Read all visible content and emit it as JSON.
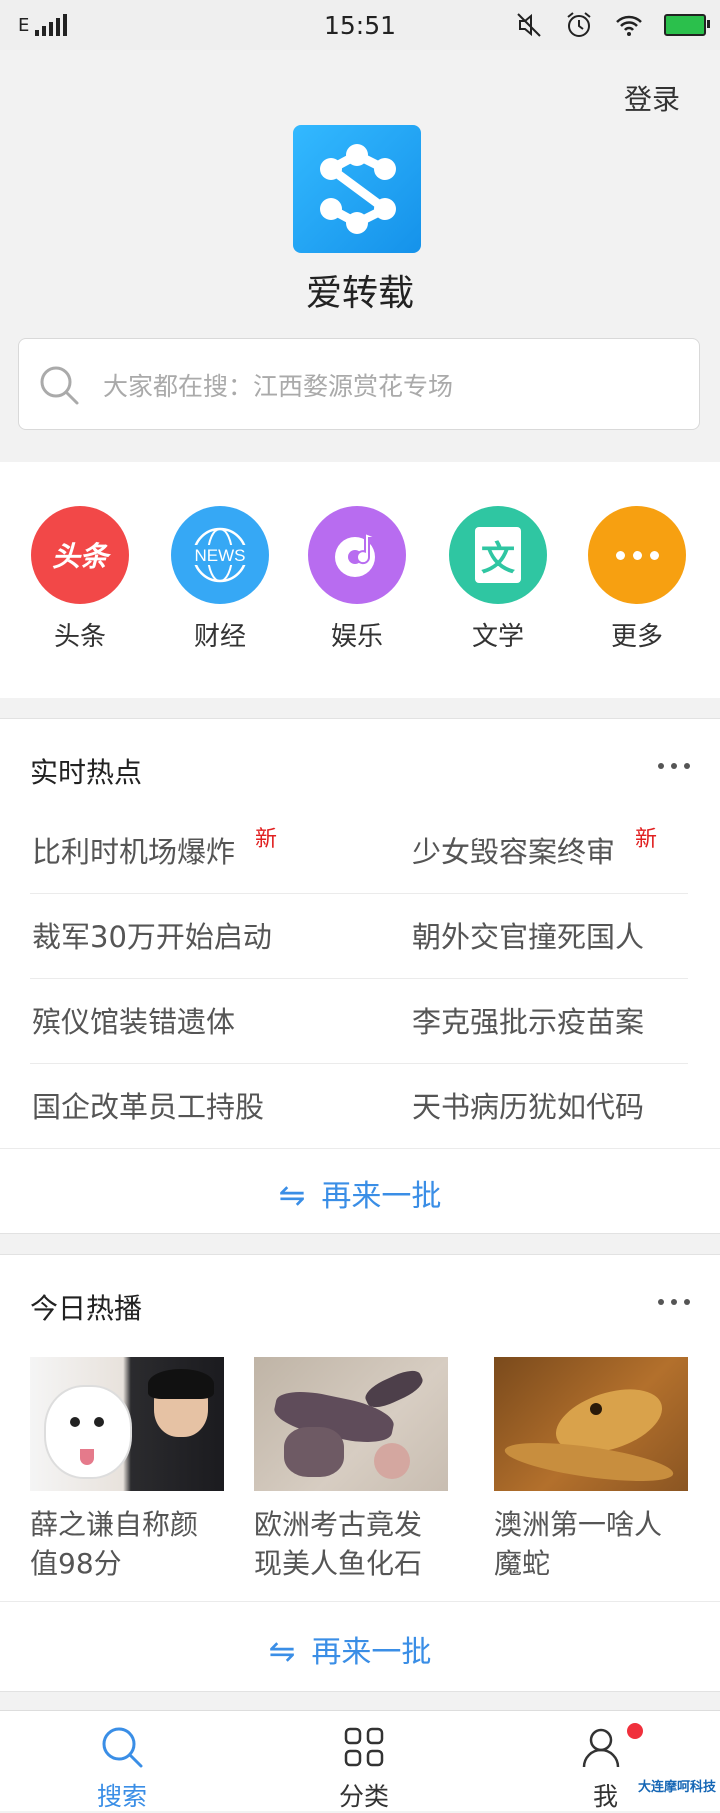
{
  "status_bar": {
    "network": "E",
    "time": "15:51"
  },
  "header": {
    "login_label": "登录",
    "app_name": "爱转载",
    "search_placeholder": "大家都在搜：江西婺源赏花专场"
  },
  "categories": [
    {
      "label": "头条",
      "icon_text": "头条",
      "color": "#f24848"
    },
    {
      "label": "财经",
      "icon_text": "NEWS",
      "color": "#36a8f5"
    },
    {
      "label": "娱乐",
      "icon_text": "",
      "color": "#b86cf0"
    },
    {
      "label": "文学",
      "icon_text": "文",
      "color": "#2fc6a2"
    },
    {
      "label": "更多",
      "icon_text": "",
      "color": "#f7a011"
    }
  ],
  "realtime": {
    "title": "实时热点",
    "new_badge": "新",
    "rows": [
      {
        "left": "比利时机场爆炸",
        "left_new": true,
        "right": "少女毁容案终审",
        "right_new": true
      },
      {
        "left": "裁军30万开始启动",
        "left_new": false,
        "right": "朝外交官撞死国人",
        "right_new": false
      },
      {
        "left": "殡仪馆装错遗体",
        "left_new": false,
        "right": "李克强批示疫苗案",
        "right_new": false
      },
      {
        "left": "国企改革员工持股",
        "left_new": false,
        "right": "天书病历犹如代码",
        "right_new": false
      }
    ],
    "refresh_label": "再来一批"
  },
  "today": {
    "title": "今日热播",
    "items": [
      {
        "title_line1": "薛之谦自称颜",
        "title_line2": "值98分"
      },
      {
        "title_line1": "欧洲考古竟发",
        "title_line2": "现美人鱼化石"
      },
      {
        "title_line1": "澳洲第一啥人",
        "title_line2": "魔蛇"
      }
    ],
    "refresh_label": "再来一批"
  },
  "bottom_nav": [
    {
      "label": "搜索",
      "active": true
    },
    {
      "label": "分类",
      "active": false
    },
    {
      "label": "我",
      "active": false
    }
  ],
  "watermark": "大连摩呵科技",
  "colors": {
    "accent": "#3a8ee6",
    "new_badge": "#e02020",
    "nav_active": "#3a8ee6"
  }
}
